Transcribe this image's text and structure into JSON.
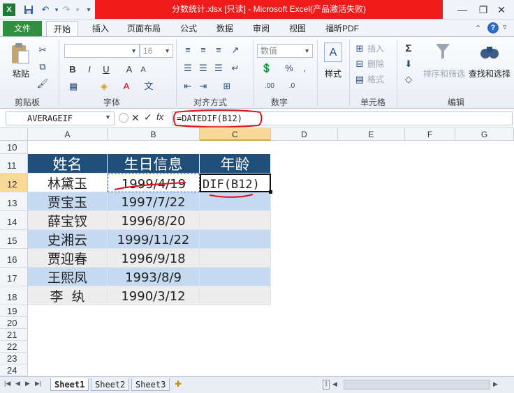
{
  "title_bar": {
    "title": "分数统计.xlsx [只读] - Microsoft Excel(产品激活失败)",
    "title_color": "#ef1a1a"
  },
  "tabs": [
    "文件",
    "开始",
    "插入",
    "页面布局",
    "公式",
    "数据",
    "审阅",
    "视图",
    "福昕PDF"
  ],
  "ribbon": {
    "paste_label": "粘贴",
    "clipboard_group": "剪贴板",
    "font_size": "16",
    "font_group": "字体",
    "align_group": "对齐方式",
    "number_format": "数值",
    "number_group": "数字",
    "style_label": "样式",
    "insert_label": "插入",
    "delete_label": "删除",
    "format_label": "格式",
    "cells_group": "单元格",
    "sort_filter_label": "排序和筛选",
    "find_select_label": "查找和选择",
    "edit_group": "编辑"
  },
  "formula_bar": {
    "name_box": "AVERAGEIF",
    "formula": "=DATEDIF(B12)"
  },
  "columns": [
    "A",
    "B",
    "C",
    "D",
    "E",
    "F",
    "G"
  ],
  "rows": [
    "10",
    "11",
    "12",
    "13",
    "14",
    "15",
    "16",
    "17",
    "18",
    "19",
    "20",
    "21",
    "22",
    "23",
    "24"
  ],
  "table": {
    "headers": [
      "姓名",
      "生日信息",
      "年龄"
    ],
    "data": [
      [
        "林黛玉",
        "1999/4/19",
        "DIF(B12)"
      ],
      [
        "贾宝玉",
        "1997/7/22",
        ""
      ],
      [
        "薛宝钗",
        "1996/8/20",
        ""
      ],
      [
        "史湘云",
        "1999/11/22",
        ""
      ],
      [
        "贾迎春",
        "1996/9/18",
        ""
      ],
      [
        "王熙凤",
        "1993/8/9",
        ""
      ],
      [
        "李  纨",
        "1990/3/12",
        ""
      ]
    ]
  },
  "sheets": [
    "Sheet1",
    "Sheet2",
    "Sheet3"
  ],
  "colors": {
    "header_fill": "#1f4e79",
    "band_fill": "#c5d9f1",
    "annotation": "#e0131b"
  }
}
